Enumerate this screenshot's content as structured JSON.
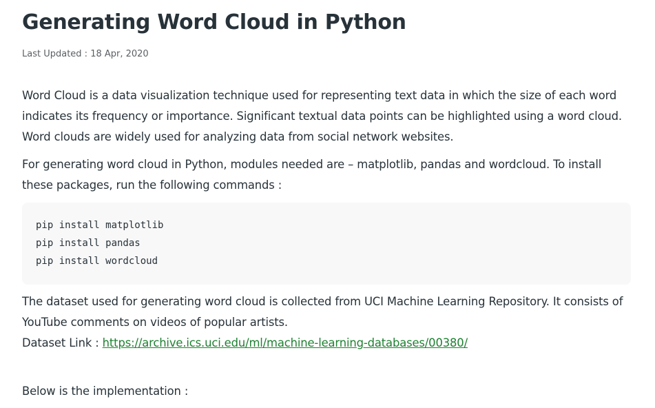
{
  "article": {
    "title": "Generating Word Cloud in Python",
    "last_updated": "Last Updated : 18 Apr, 2020",
    "paragraph_1": "Word Cloud is a data visualization technique used for representing text data in which the size of each word indicates its frequency or importance. Significant textual data points can be highlighted using a word cloud. Word clouds are widely used for analyzing data from social network websites.",
    "paragraph_2": "For generating word cloud in Python, modules needed are – matplotlib, pandas and wordcloud. To install these packages, run the following commands :",
    "code_lines": [
      "pip install matplotlib",
      "pip install pandas",
      "pip install wordcloud"
    ],
    "paragraph_3": "The dataset used for generating word cloud is collected from UCI Machine Learning Repository. It consists of YouTube comments on videos of popular artists.",
    "dataset_link_label": "Dataset Link : ",
    "dataset_link_url": "https://archive.ics.uci.edu/ml/machine-learning-databases/00380/",
    "paragraph_4": "Below is the implementation :"
  },
  "colors": {
    "text": "#273239",
    "meta": "#5a5f63",
    "link": "#1e8131",
    "code_background": "#f8f8f8"
  }
}
